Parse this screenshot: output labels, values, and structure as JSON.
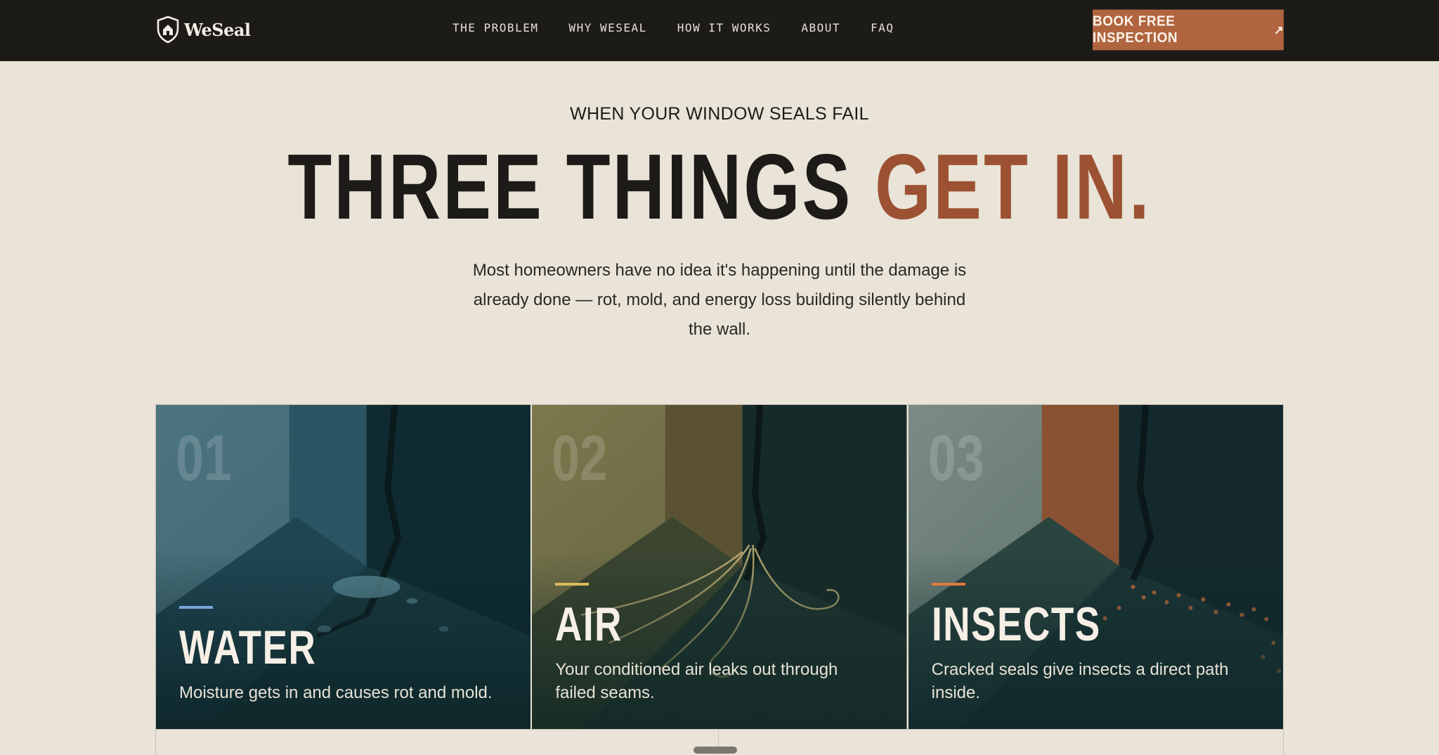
{
  "brand": {
    "name": "WeSeal",
    "logo_icon": "shield-house-icon"
  },
  "nav": {
    "links": [
      "THE PROBLEM",
      "WHY WESEAL",
      "HOW IT WORKS",
      "ABOUT",
      "FAQ"
    ],
    "cta_label": "BOOK FREE INSPECTION",
    "cta_icon": "arrow-up-right-icon"
  },
  "hero": {
    "eyebrow": "WHEN YOUR WINDOW SEALS FAIL",
    "headline_main": "THREE THINGS ",
    "headline_accent": "GET IN.",
    "subtext": "Most homeowners have no idea it's happening until the damage is already done — rot, mold, and energy loss building silently behind the wall."
  },
  "cards": [
    {
      "number": "01",
      "title": "WATER",
      "description": "Moisture gets in and causes rot and mold.",
      "accent": "#7aa6d6",
      "icon": "water-leak-illustration"
    },
    {
      "number": "02",
      "title": "AIR",
      "description": "Your conditioned air leaks out through failed seams.",
      "accent": "#d9b95a",
      "icon": "air-draft-illustration"
    },
    {
      "number": "03",
      "title": "INSECTS",
      "description": "Cracked seals give insects a direct path inside.",
      "accent": "#e07a3e",
      "icon": "insects-illustration"
    }
  ],
  "colors": {
    "background": "#e9e3d8",
    "nav_bg": "#1d1b18",
    "cta_bg": "#b0653f",
    "headline_accent": "#9c5232"
  }
}
